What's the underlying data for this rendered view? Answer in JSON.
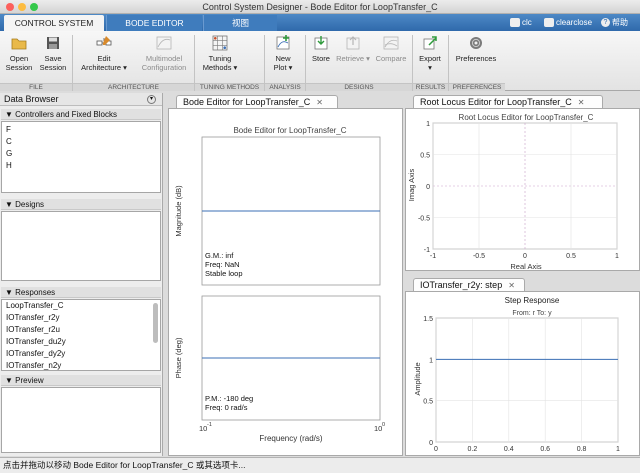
{
  "window": {
    "title": "Control System Designer - Bode Editor for LoopTransfer_C"
  },
  "tabs": [
    {
      "label": "CONTROL SYSTEM",
      "active": true
    },
    {
      "label": "BODE EDITOR",
      "active": false
    },
    {
      "label": "视图",
      "active": false
    }
  ],
  "quick": {
    "clc": "clc",
    "clearclose": "clearclose",
    "help": "帮助"
  },
  "ribbon": {
    "open_session": "Open\nSession",
    "save_session": "Save\nSession",
    "edit_arch": "Edit\nArchitecture ▾",
    "multimodel": "Multimodel\nConfiguration",
    "tuning": "Tuning\nMethods ▾",
    "new_plot": "New\nPlot ▾",
    "store": "Store",
    "retrieve": "Retrieve ▾",
    "compare": "Compare",
    "export": "Export\n▾",
    "preferences": "Preferences",
    "sections": {
      "file": "FILE",
      "architecture": "ARCHITECTURE",
      "tuning": "TUNING METHODS",
      "analysis": "ANALYSIS",
      "designs": "DESIGNS",
      "results": "RESULTS",
      "preferences": "PREFERENCES"
    }
  },
  "data_browser": {
    "title": "Data Browser",
    "controllers_header": "Controllers and Fixed Blocks",
    "controllers": [
      "F",
      "C",
      "G",
      "H"
    ],
    "designs_header": "Designs",
    "responses_header": "Responses",
    "responses": [
      "LoopTransfer_C",
      "IOTransfer_r2y",
      "IOTransfer_r2u",
      "IOTransfer_du2y",
      "IOTransfer_dy2y",
      "IOTransfer_n2y"
    ],
    "preview_header": "Preview"
  },
  "bode": {
    "tab_label": "Bode Editor for LoopTransfer_C",
    "title": "Bode Editor for LoopTransfer_C",
    "mag_label": "Magnitude (dB)",
    "phase_label": "Phase (deg)",
    "xlabel": "Frequency (rad/s)",
    "gm": "G.M.: inf",
    "freq1": "Freq: NaN",
    "stable": "Stable loop",
    "pm": "P.M.: -180 deg",
    "freq2": "Freq: 0 rad/s",
    "xtick_lo": "10",
    "xtick_lo_exp": "-1",
    "xtick_hi": "10",
    "xtick_hi_exp": "0"
  },
  "root_locus": {
    "tab_label": "Root Locus Editor for LoopTransfer_C",
    "title": "Root Locus Editor for LoopTransfer_C",
    "ylabel": "Imag Axis",
    "xlabel": "Real Axis",
    "yticks": [
      "1",
      "0.5",
      "0",
      "-0.5",
      "-1"
    ],
    "xticks": [
      "-1",
      "-0.5",
      "0",
      "0.5",
      "1"
    ]
  },
  "step": {
    "tab_label": "IOTransfer_r2y: step",
    "title": "Step Response",
    "subtitle": "From: r  To: y",
    "ylabel": "Amplitude",
    "yticks": [
      "1.5",
      "1",
      "0.5",
      "0"
    ],
    "xticks": [
      "0",
      "0.2",
      "0.4",
      "0.6",
      "0.8",
      "1"
    ]
  },
  "status": {
    "text": "点击并拖动以移动 Bode Editor for LoopTransfer_C 或其选项卡..."
  },
  "colors": {
    "tab_blue": "#3a75b8",
    "line_blue": "#3b6fb5",
    "grid": "#e3e3e3"
  }
}
